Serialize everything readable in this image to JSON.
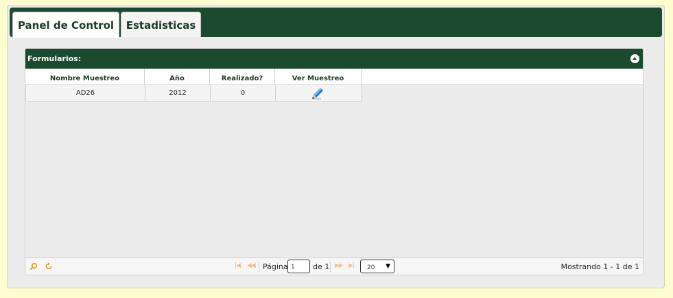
{
  "tabs": [
    {
      "label": "Panel de Control",
      "active": true
    },
    {
      "label": "Estadisticas",
      "active": false
    }
  ],
  "grid": {
    "title": "Formularios:",
    "columns": [
      "Nombre Muestreo",
      "Año",
      "Realizado?",
      "Ver Muestreo"
    ],
    "rows": [
      {
        "nombre": "AD26",
        "anio": "2012",
        "realizado": "0",
        "ver_icon": "pencil-icon"
      }
    ]
  },
  "pager": {
    "page_label": "Página",
    "page_value": "1",
    "of_label": "de 1",
    "rows_per_page": "20",
    "status": "Mostrando 1 - 1 de 1",
    "icons": [
      "search-icon",
      "refresh-icon",
      "first-page-icon",
      "prev-page-icon",
      "next-page-icon",
      "last-page-icon"
    ]
  },
  "colors": {
    "page_bg": "#fdfdd0",
    "header_green": "#1c4a2e",
    "nav_disabled": "#f3c08a",
    "icon_orange": "#e8941a",
    "pencil_blue": "#2a74d8"
  }
}
